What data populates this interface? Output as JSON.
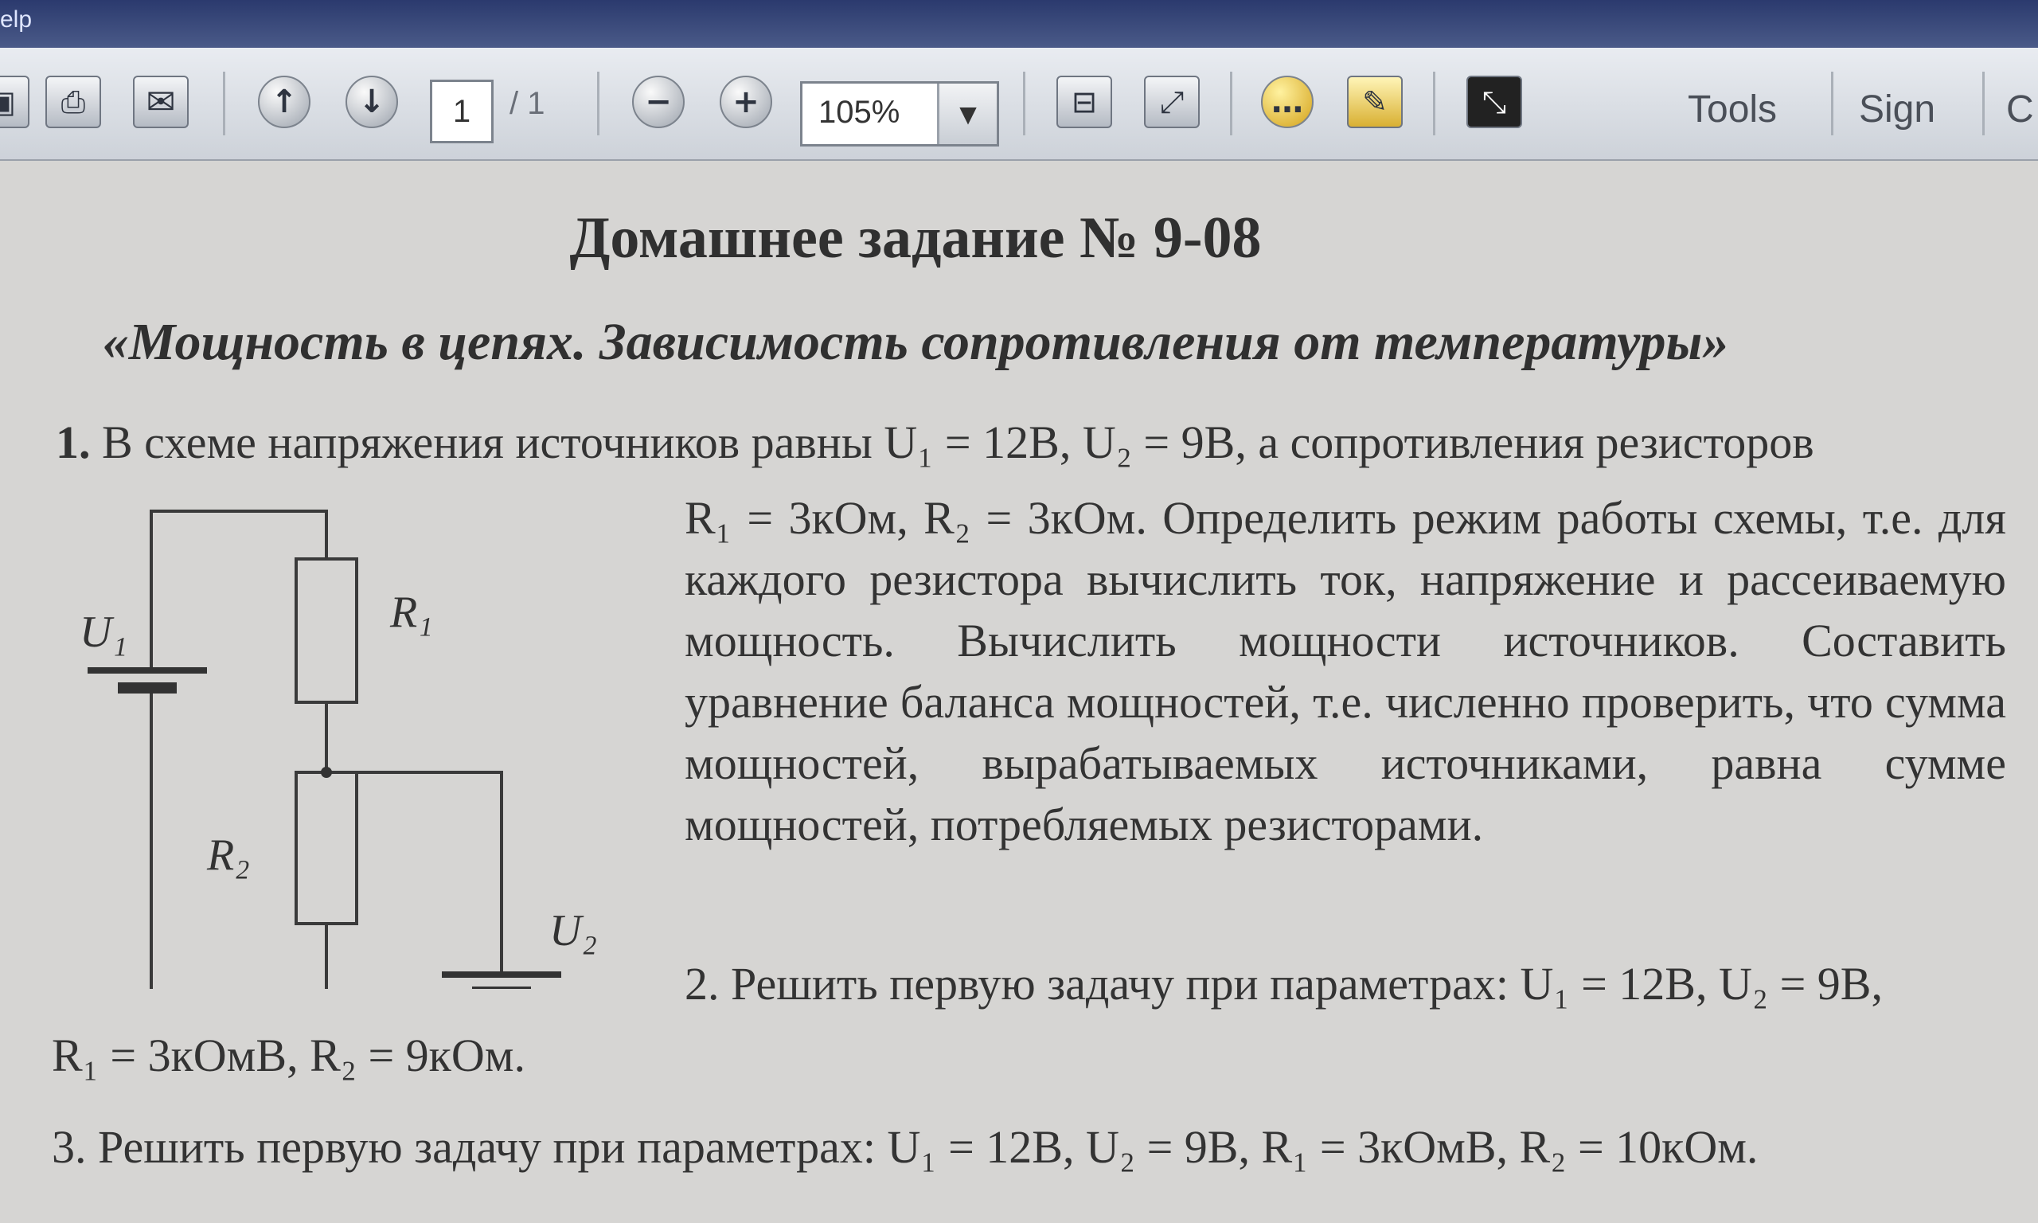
{
  "menu": {
    "help_fragment": "elp"
  },
  "toolbar": {
    "page_current": "1",
    "page_total": "/ 1",
    "zoom": "105%",
    "tools_label": "Tools",
    "sign_label": "Sign",
    "cut_label": "C",
    "icons": [
      "save-icon",
      "print-icon",
      "email-icon",
      "page-up-icon",
      "page-down-icon",
      "zoom-out-icon",
      "zoom-in-icon",
      "fit-page-icon",
      "fit-width-icon",
      "comment-icon",
      "highlight-icon",
      "fullscreen-icon"
    ]
  },
  "document": {
    "title": "Домашнее задание № 9-08",
    "subtitle": "«Мощность в цепях. Зависимость сопротивления от температуры»",
    "problem1": {
      "number": "1.",
      "lead": "В схеме напряжения источников равны U₁ = 12В, U₂ = 9В, а сопротивления резисторов",
      "body": "R₁ = 3кОм, R₂ = 3кОм. Определить режим работы схемы, т.е. для каждого резистора вычислить ток, напряжение и рассеиваемую мощность. Вычислить мощности источников. Составить уравнение баланса мощностей, т.е. численно проверить, что сумма мощностей, вырабатываемых источниками, равна сумме мощностей, потребляемых резисторами."
    },
    "problem2": {
      "lead": "2. Решить первую задачу при параметрах: U₁ = 12В, U₂ = 9В,",
      "tail": "R₁ = 3кОмВ, R₂ = 9кОм."
    },
    "problem3": {
      "text": "3. Решить первую задачу при параметрах: U₁ = 12В, U₂ = 9В, R₁ = 3кОмВ, R₂ = 10кОм."
    },
    "circuit": {
      "labels": {
        "u1": "U₁",
        "u2": "U₂",
        "r1": "R₁",
        "r2": "R₂"
      }
    }
  }
}
